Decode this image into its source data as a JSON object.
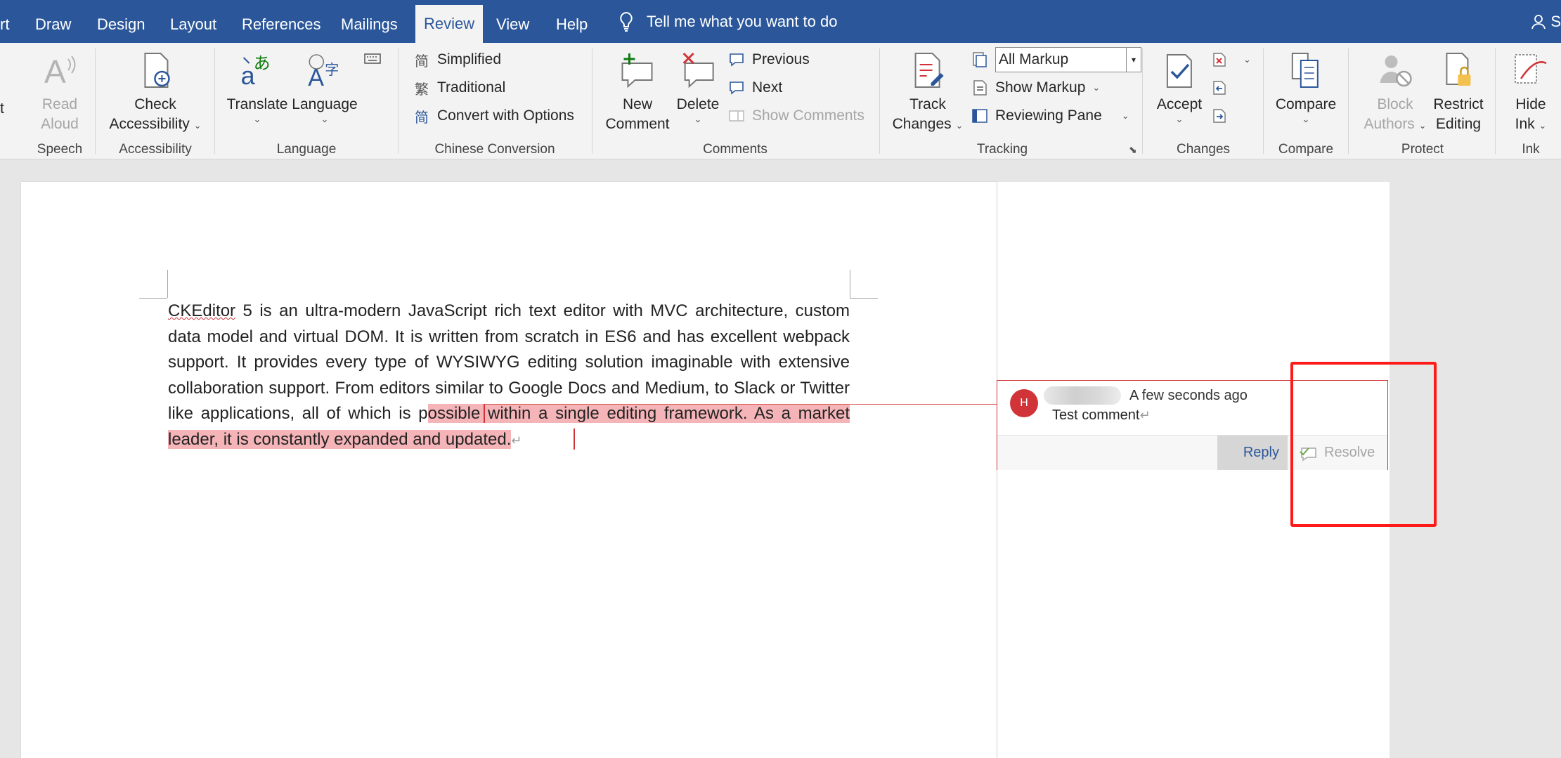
{
  "tabs": [
    {
      "label": "rt",
      "active": false
    },
    {
      "label": "Draw",
      "active": false
    },
    {
      "label": "Design",
      "active": false
    },
    {
      "label": "Layout",
      "active": false
    },
    {
      "label": "References",
      "active": false
    },
    {
      "label": "Mailings",
      "active": false
    },
    {
      "label": "Review",
      "active": true
    },
    {
      "label": "View",
      "active": false
    },
    {
      "label": "Help",
      "active": false
    }
  ],
  "tell_me": "Tell me what you want to do",
  "user_initial": "S",
  "colors": {
    "ribbon_blue": "#2b579a",
    "comment_red": "#d13438",
    "highlight": "#f4b4b8"
  },
  "ribbon": {
    "speech": {
      "read_aloud_line1": "Read",
      "read_aloud_line2": "Aloud",
      "label": "Speech",
      "cut_label": "t"
    },
    "accessibility": {
      "check_line1": "Check",
      "check_line2": "Accessibility",
      "label": "Accessibility"
    },
    "language": {
      "translate": "Translate",
      "language": "Language",
      "label": "Language"
    },
    "chinese": {
      "simplified": "Simplified",
      "traditional": "Traditional",
      "convert": "Convert with Options",
      "label": "Chinese Conversion",
      "simplified_glyph": "简",
      "traditional_glyph": "繁",
      "convert_glyph": "简"
    },
    "comments": {
      "new_line1": "New",
      "new_line2": "Comment",
      "delete": "Delete",
      "previous": "Previous",
      "next": "Next",
      "show": "Show Comments",
      "label": "Comments"
    },
    "tracking": {
      "track_line1": "Track",
      "track_line2": "Changes",
      "markup_select": "All Markup",
      "show_markup": "Show Markup",
      "reviewing_pane": "Reviewing Pane",
      "label": "Tracking"
    },
    "changes": {
      "accept": "Accept",
      "label": "Changes"
    },
    "compare": {
      "compare": "Compare",
      "label": "Compare"
    },
    "protect": {
      "block_line1": "Block",
      "block_line2": "Authors",
      "restrict_line1": "Restrict",
      "restrict_line2": "Editing",
      "label": "Protect"
    },
    "ink": {
      "hide_line1": "Hide",
      "hide_line2": "Ink",
      "label": "Ink"
    }
  },
  "document": {
    "word1": "CKEditor",
    "text_before": " 5 is an ultra-modern JavaScript rich text editor with MVC architecture, custom data model and virtual DOM. It is written from scratch in ES6 and has excellent webpack support. It provides every type of WYSIWYG editing solution imaginable with extensive collaboration support. From editors similar to Google Docs and Medium, to Slack or Twitter like applications, all of which is p",
    "text_highlighted": "ossible within a single editing framework. As a market leader, it is constantly expanded and updated.",
    "pilcrow": "↵"
  },
  "comment": {
    "avatar": "H",
    "time": "A few seconds ago",
    "text": "Test comment",
    "pilcrow": "↵",
    "reply": "Reply",
    "resolve": "Resolve"
  }
}
